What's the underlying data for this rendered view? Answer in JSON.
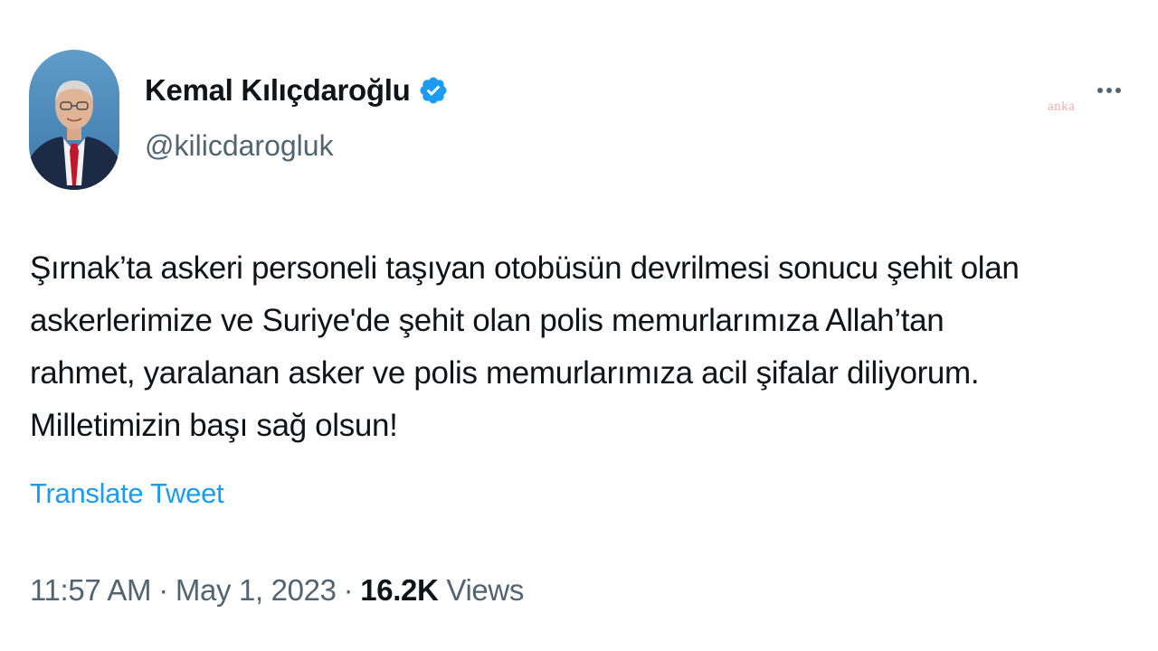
{
  "author": {
    "display_name": "Kemal Kılıçdaroğlu",
    "handle": "@kilicdarogluk",
    "verified_icon": "verified-badge-icon"
  },
  "tweet": {
    "text": "Şırnak’ta askeri personeli taşıyan otobüsün devrilmesi sonucu şehit olan\naskerlerimize ve Suriye'de şehit olan polis memurlarımıza Allah’tan\nrahmet, yaralanan asker ve polis memurlarımıza acil şifalar diliyorum.\nMilletimizin başı sağ olsun!",
    "translate_label": "Translate Tweet"
  },
  "meta": {
    "time": "11:57 AM",
    "separator": "·",
    "date": "May 1, 2023",
    "views_count": "16.2K",
    "views_label": "Views"
  },
  "watermark": {
    "text": "anka"
  },
  "colors": {
    "link": "#1d9bf0",
    "verified": "#1d9bf0",
    "secondary_text": "#536471",
    "primary_text": "#0f1419"
  }
}
